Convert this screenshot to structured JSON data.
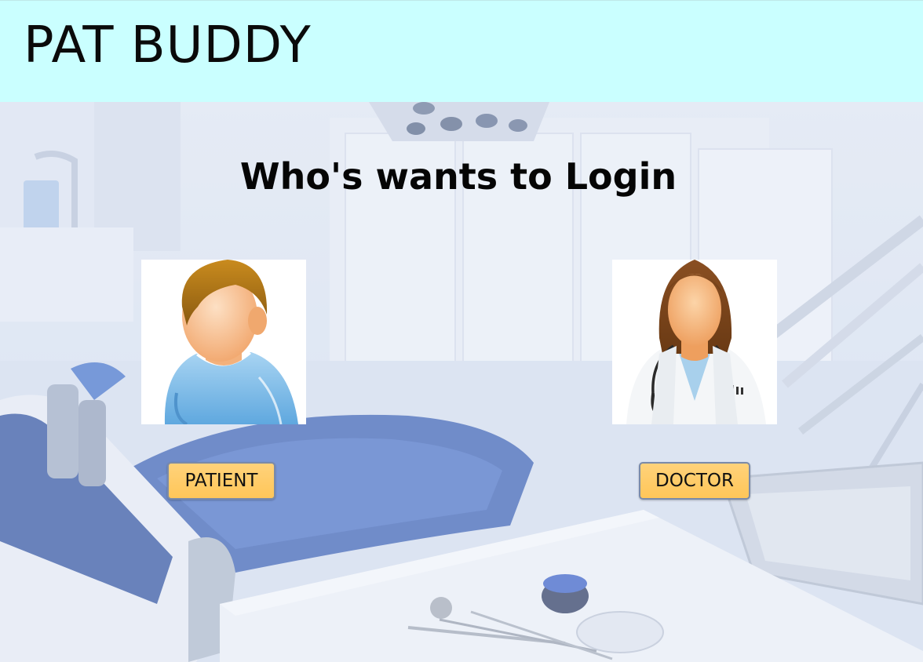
{
  "header": {
    "title": "PAT BUDDY",
    "background_color": "#caffff"
  },
  "main": {
    "heading": "Who's wants to Login",
    "roles": [
      {
        "label": "PATIENT",
        "icon": "patient-avatar-icon"
      },
      {
        "label": "DOCTOR",
        "icon": "doctor-avatar-icon"
      }
    ],
    "button_color": "#ffc659",
    "background_image": "dental-clinic-photo"
  }
}
